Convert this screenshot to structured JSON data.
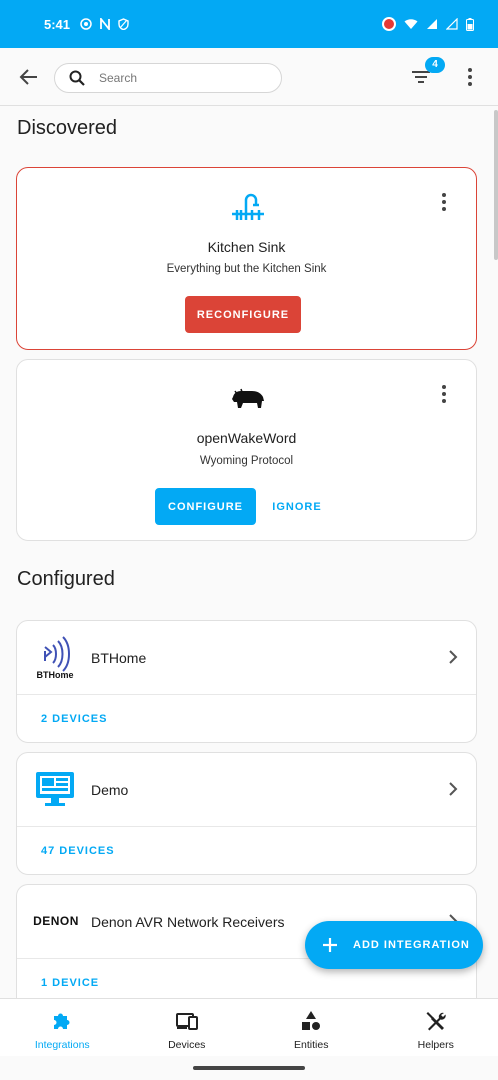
{
  "status_bar": {
    "time": "5:41"
  },
  "search": {
    "placeholder": "Search"
  },
  "filter": {
    "badge_count": "4"
  },
  "discovered": {
    "title": "Discovered",
    "cards": [
      {
        "name": "Kitchen Sink",
        "subtitle": "Everything but the Kitchen Sink",
        "primary_button": "RECONFIGURE",
        "icon": "sink-icon",
        "accent": "#db4437"
      },
      {
        "name": "openWakeWord",
        "subtitle": "Wyoming Protocol",
        "primary_button": "CONFIGURE",
        "secondary_button": "IGNORE",
        "icon": "bison-icon",
        "accent": "#03a9f4"
      }
    ]
  },
  "configured": {
    "title": "Configured",
    "cards": [
      {
        "name": "BTHome",
        "devices": "2 DEVICES",
        "logo_text": "BTHome"
      },
      {
        "name": "Demo",
        "devices": "47 DEVICES",
        "icon": "monitor-icon"
      },
      {
        "name": "Denon AVR Network Receivers",
        "devices": "1 DEVICE",
        "logo_text": "DENON"
      }
    ]
  },
  "fab": {
    "label": "ADD INTEGRATION"
  },
  "bottom_nav": {
    "items": [
      {
        "label": "Integrations",
        "icon": "puzzle-icon",
        "active": true
      },
      {
        "label": "Devices",
        "icon": "devices-icon"
      },
      {
        "label": "Entities",
        "icon": "shapes-icon"
      },
      {
        "label": "Helpers",
        "icon": "tools-icon"
      }
    ]
  },
  "colors": {
    "primary": "#03a9f4",
    "error": "#db4437"
  }
}
